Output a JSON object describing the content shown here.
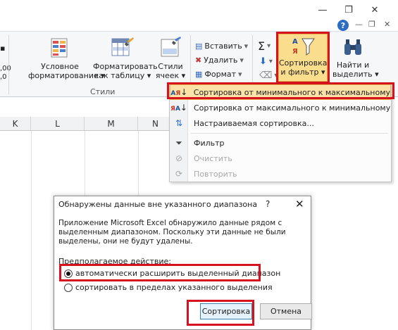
{
  "window": {
    "controls": {
      "minimize": "—",
      "restore": "❐",
      "close": "✕"
    },
    "help": "?",
    "small_controls": [
      "—",
      "❐",
      "✕"
    ]
  },
  "ribbon": {
    "left_edge": {
      "top": "▪",
      "number": ",00",
      "decimal": ",0"
    },
    "styles_group": {
      "name": "Стили",
      "buttons": [
        {
          "line1": "Условное",
          "line2": "форматирование",
          "arrow": "▾"
        },
        {
          "line1": "Форматировать",
          "line2": "как таблицу",
          "arrow": "▾"
        },
        {
          "line1": "Стили",
          "line2": "ячеек",
          "arrow": "▾"
        }
      ]
    },
    "cells_group": {
      "insert": "Вставить",
      "delete": "Удалить",
      "format": "Формат"
    },
    "editing_group": {
      "sigma": "Σ",
      "sort_filter": {
        "line1": "Сортировка",
        "line2": "и фильтр",
        "arrow": "▾"
      },
      "find_select": {
        "line1": "Найти и",
        "line2": "выделить",
        "arrow": "▾"
      }
    }
  },
  "columns": [
    "K",
    "L",
    "M",
    "N"
  ],
  "sort_menu": {
    "items": [
      {
        "label": "Сортировка от минимального к максимальному",
        "icon": "sort-asc-icon",
        "state": "selected"
      },
      {
        "label": "Сортировка от максимального к минимальному",
        "icon": "sort-desc-icon",
        "state": "normal"
      },
      {
        "label": "Настраиваемая сортировка...",
        "icon": "custom-sort-icon",
        "state": "normal"
      },
      {
        "label": "Фильтр",
        "icon": "filter-icon",
        "state": "normal"
      },
      {
        "label": "Очистить",
        "icon": "clear-filter-icon",
        "state": "disabled"
      },
      {
        "label": "Повторить",
        "icon": "reapply-icon",
        "state": "disabled"
      }
    ]
  },
  "dialog": {
    "title": "Обнаружены данные вне указанного диапазона",
    "help": "?",
    "close": "✕",
    "message": "Приложение Microsoft Excel обнаружило данные рядом с выделенным диапазоном. Поскольку эти данные не были выделены, они не будут удалены.",
    "subtitle": "Предполагаемое действие:",
    "options": [
      {
        "label": "автоматически расширить выделенный диапазон",
        "checked": true
      },
      {
        "label": "сортировать в пределах указанного выделения",
        "checked": false
      }
    ],
    "ok_label": "Сортировка",
    "cancel_label": "Отмена"
  },
  "colors": {
    "highlight": "#d6121f",
    "menu_hover": "#fbe3a8"
  }
}
